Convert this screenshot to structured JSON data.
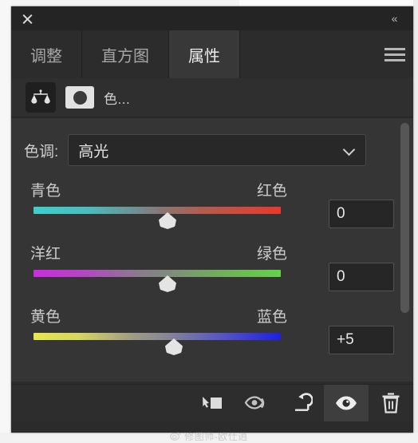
{
  "window": {
    "close_label": "×",
    "collapse_label": "«"
  },
  "tabs": [
    {
      "label": "调整",
      "active": false
    },
    {
      "label": "直方图",
      "active": false
    },
    {
      "label": "属性",
      "active": true
    }
  ],
  "menu": {
    "icon": "hamburger-icon"
  },
  "adjustment": {
    "type_icon": "color-balance-icon",
    "mask_icon": "layer-mask-thumbnail",
    "title": "色..."
  },
  "tone": {
    "label": "色调:",
    "value": "高光",
    "chevron": "chevron-down-icon"
  },
  "sliders": [
    {
      "left_label": "青色",
      "right_label": "红色",
      "value": "0",
      "thumb_percent": 50,
      "rail_class": "rail-cyan-red",
      "colors": {
        "left": "#3ccfcf",
        "mid": "#8a7573",
        "right": "#e8392b"
      }
    },
    {
      "left_label": "洋红",
      "right_label": "绿色",
      "value": "0",
      "thumb_percent": 50,
      "rail_class": "rail-magenta-green",
      "colors": {
        "left": "#cb2ce0",
        "mid": "#80897f",
        "right": "#63d24a"
      }
    },
    {
      "left_label": "黄色",
      "right_label": "蓝色",
      "value": "+5",
      "thumb_percent": 55,
      "rail_class": "rail-yellow-blue",
      "colors": {
        "left": "#e7e74c",
        "mid": "#8a8795",
        "right": "#1f1fe2"
      }
    }
  ],
  "footer_buttons": [
    {
      "name": "clip-to-layer-icon",
      "active": false
    },
    {
      "name": "preview-toggle-icon",
      "active": false
    },
    {
      "name": "reset-icon",
      "active": false
    },
    {
      "name": "visibility-eye-icon",
      "active": true
    },
    {
      "name": "trash-icon",
      "active": false
    }
  ],
  "watermark": {
    "text": "修图师-欧仕逍",
    "icon": "weibo-icon"
  },
  "theme": {
    "panel_bg": "#2b2b2b",
    "body_bg": "#353535",
    "tab_active_bg": "#383838",
    "text": "#cccccc"
  }
}
